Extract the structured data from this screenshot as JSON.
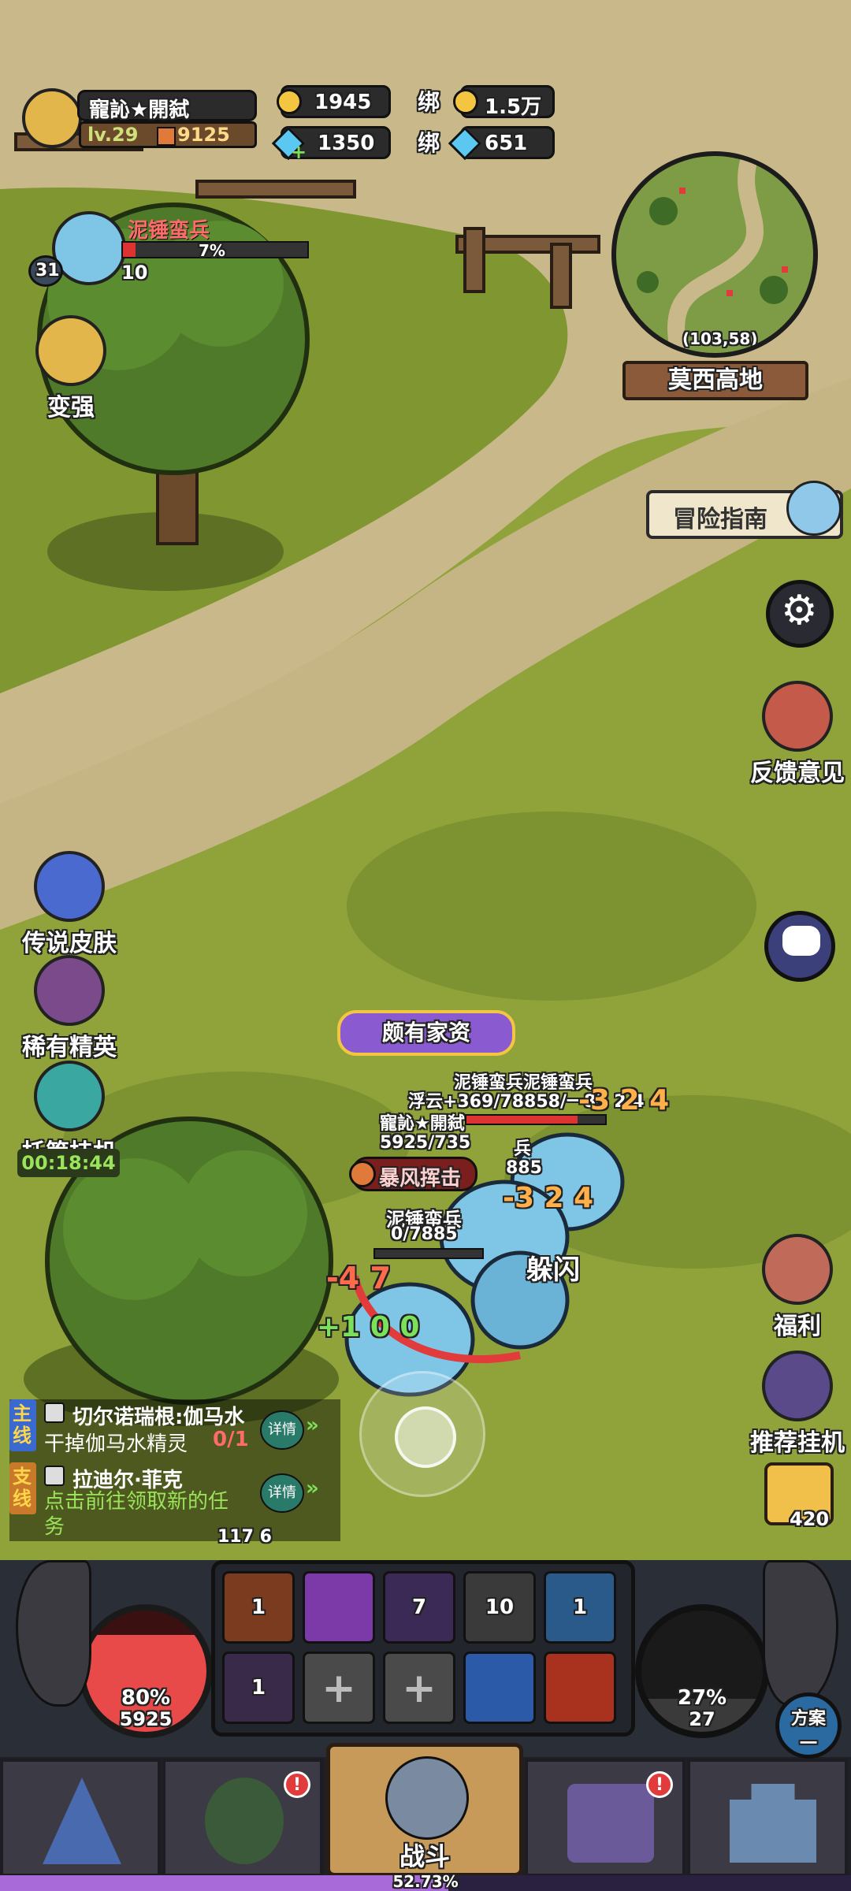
{
  "player": {
    "name": "寵訫★開弑",
    "level": "lv.29",
    "power": "9125"
  },
  "currency": {
    "gold": "1945",
    "bound_label_1": "绑",
    "bound_gold": "1.5万",
    "diamond": "1350",
    "bound_label_2": "绑",
    "bound_diamond": "651"
  },
  "target": {
    "name": "泥锤蛮兵",
    "level": "31",
    "hp_percent": 7,
    "hp_text": "7%",
    "count": "10"
  },
  "minimap": {
    "coords": "(103,58)",
    "region": "莫西高地"
  },
  "left_menu": {
    "strengthen": "变强",
    "legend_skin": "传说皮肤",
    "rare_elite": "稀有精英",
    "auto_idle": "托管挂机",
    "timer": "00:18:44"
  },
  "right_menu": {
    "guide": "冒险指南",
    "feedback": "反馈意见",
    "welfare": "福利",
    "recommend_idle": "推荐挂机",
    "cheese_count": "420"
  },
  "battle": {
    "title_badge": "颇有家资",
    "enemy_top_label": "泥锤蛮兵泥锤蛮兵",
    "float_line": "浮云+369/78858/一83 2 4",
    "self_name": "寵訫★開弑",
    "self_hp": "5925/735",
    "hidden_enemy_label": "兵",
    "hidden_hp": "885",
    "skill_name": "暴风挥击",
    "damage_1": "-3 2 4",
    "damage_2": "-3 2 4",
    "enemy_name_2": "泥锤蛮兵",
    "enemy_hp_2": "0/7885",
    "dodge": "躲闪",
    "damage_3": "-4 7",
    "heal": "+1 0 0"
  },
  "quests": {
    "main_tag": "主线",
    "main_title": "切尔诺瑞根:伽马水",
    "main_desc": "干掉伽马水精灵",
    "main_progress": "0/1",
    "main_detail": "详情",
    "side_tag": "支线",
    "side_title": "拉迪尔·菲克",
    "side_desc": "点击前往领取新的任务",
    "side_detail": "详情",
    "bottom_numbers": "117  6"
  },
  "skills": [
    {
      "count": "1",
      "color": "#7a3b1e"
    },
    {
      "count": "",
      "color": "#7b3aa8"
    },
    {
      "count": "7",
      "color": "#3b2a55"
    },
    {
      "count": "10",
      "color": "#3a3a3a"
    },
    {
      "count": "1",
      "color": "#2a5a8a"
    },
    {
      "count": "1",
      "color": "#3a2a4a"
    },
    {
      "count": "",
      "color": "#4a4a4a"
    },
    {
      "count": "",
      "color": "#4a4a4a"
    },
    {
      "count": "",
      "color": "#2a5aa8"
    },
    {
      "count": "",
      "color": "#a8321e"
    }
  ],
  "hp_orb": {
    "percent": "80%",
    "value": "5925",
    "fill_fraction": 0.8
  },
  "mp_orb": {
    "percent": "27%",
    "value": "27",
    "fill_fraction": 0.27
  },
  "plan_button": {
    "line1": "方案",
    "line2": "一"
  },
  "bottom_nav": {
    "battle_label": "战斗"
  },
  "exp": {
    "text": "52.73%",
    "fraction": 0.5273
  },
  "colors": {
    "grass": "#8fa33a",
    "path": "#c9b98a",
    "accent_red": "#e23b3b",
    "gold": "#f3c540",
    "green_text": "#9be35a"
  }
}
